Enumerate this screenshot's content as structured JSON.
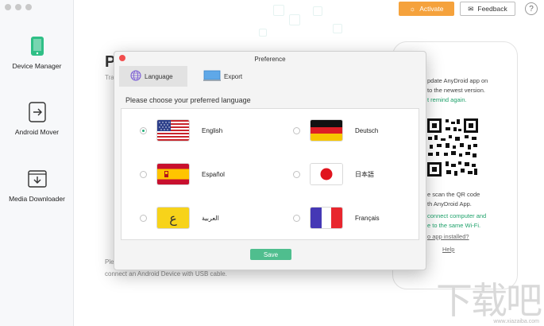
{
  "sidebar": {
    "items": [
      {
        "label": "Device Manager",
        "icon": "phone-icon"
      },
      {
        "label": "Android Mover",
        "icon": "transfer-icon"
      },
      {
        "label": "Media Downloader",
        "icon": "download-icon"
      }
    ]
  },
  "header": {
    "activate_label": "Activate",
    "feedback_label": "Feedback",
    "help_label": "?"
  },
  "background": {
    "title_initial": "P",
    "subtitle_fragment": "Tra",
    "footer_line1": "Ple",
    "footer_line2": "connect an Android Device with USB cable."
  },
  "phone_panel": {
    "update_line1": "pdate AnyDroid app on",
    "update_line2": "to the newest version.",
    "no_remind": "t remind again.",
    "scan_line1": "e scan the QR code",
    "scan_line2": "th AnyDroid App.",
    "connect_line1": "connect computer and",
    "connect_line2": "e to the same Wi-Fi.",
    "app_installed": "o app installed?",
    "help": "Help"
  },
  "dialog": {
    "title": "Preference",
    "tabs": [
      {
        "label": "Language",
        "active": true,
        "icon": "globe-icon"
      },
      {
        "label": "Export",
        "active": false,
        "icon": "monitor-icon"
      }
    ],
    "prompt": "Please choose your preferred language",
    "languages": [
      {
        "label": "English",
        "selected": true,
        "flag": "us-flag-icon"
      },
      {
        "label": "Deutsch",
        "selected": false,
        "flag": "de-flag-icon"
      },
      {
        "label": "Español",
        "selected": false,
        "flag": "es-flag-icon"
      },
      {
        "label": "日本語",
        "selected": false,
        "flag": "jp-flag-icon"
      },
      {
        "label": "العربية",
        "selected": false,
        "flag": "arabic-flag-icon",
        "flag_glyph": "ع"
      },
      {
        "label": "Français",
        "selected": false,
        "flag": "fr-flag-icon"
      }
    ],
    "save_label": "Save"
  },
  "colors": {
    "accent_green": "#4fbe8e",
    "activate_orange": "#f5a23c",
    "close_red": "#f24e4e"
  }
}
